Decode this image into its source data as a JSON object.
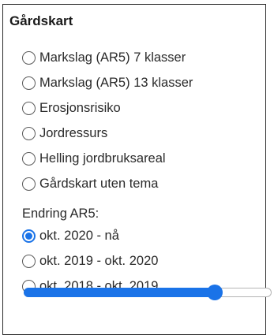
{
  "panel": {
    "title": "Gårdskart",
    "theme_options": [
      {
        "label": "Markslag (AR5) 7 klasser",
        "checked": false
      },
      {
        "label": "Markslag (AR5) 13 klasser",
        "checked": false
      },
      {
        "label": "Erosjonsrisiko",
        "checked": false
      },
      {
        "label": "Jordressurs",
        "checked": false
      },
      {
        "label": "Helling jordbruksareal",
        "checked": false
      },
      {
        "label": "Gårdskart uten tema",
        "checked": false
      }
    ],
    "change_section_label": "Endring AR5:",
    "change_options": [
      {
        "label": "okt. 2020 - nå",
        "checked": true
      },
      {
        "label": "okt. 2019 - okt. 2020",
        "checked": false
      },
      {
        "label": "okt. 2018 - okt. 2019",
        "checked": false
      }
    ],
    "slider": {
      "value_fraction": 0.77,
      "color": "#1a73e8"
    }
  }
}
